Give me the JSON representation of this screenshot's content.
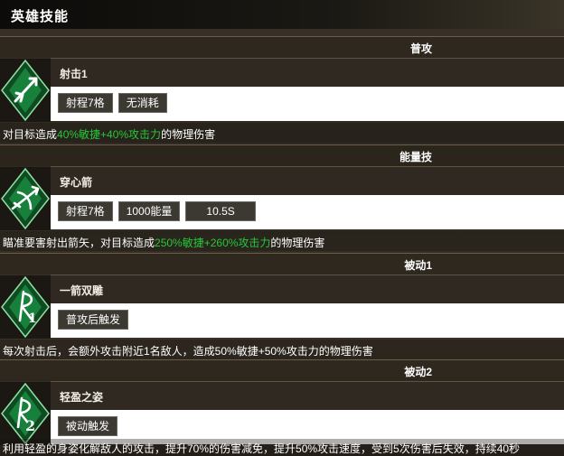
{
  "window_title": "英雄技能",
  "colors": {
    "highlight": "#26c73a",
    "tag_bg": "#3c3933",
    "icon_green": "#1a8a3a"
  },
  "skills": [
    {
      "category": "普攻",
      "name": "射击1",
      "icon": "arrow-shot-icon",
      "tags": [
        "射程7格",
        "无消耗"
      ],
      "desc": {
        "pre": "对目标造成",
        "hl": "40%敏捷+40%攻击力",
        "post": "的物理伤害"
      }
    },
    {
      "category": "能量技",
      "name": "穿心箭",
      "icon": "piercing-arrow-icon",
      "tags": [
        "射程7格",
        "1000能量",
        "10.5S"
      ],
      "desc": {
        "pre": "瞄准要害射出箭矢，对目标造成",
        "hl": "250%敏捷+260%攻击力",
        "post": "的物理伤害"
      }
    },
    {
      "category": "被动1",
      "name": "一箭双雕",
      "icon": "passive-1-icon",
      "tags": [
        "普攻后触发"
      ],
      "desc": {
        "pre": "每次射击后，会额外攻击附近1名敌人，造成50%敏捷+50%攻击力的物理伤害",
        "hl": "",
        "post": ""
      }
    },
    {
      "category": "被动2",
      "name": "轻盈之姿",
      "icon": "passive-2-icon",
      "tags": [
        "被动触发"
      ],
      "desc": {
        "pre": "利用轻盈的身姿化解敌人的攻击，提升70%的伤害减免，提升50%攻击速度，受到5次伤害后失效，持续40秒",
        "hl": "",
        "post": ""
      }
    }
  ]
}
